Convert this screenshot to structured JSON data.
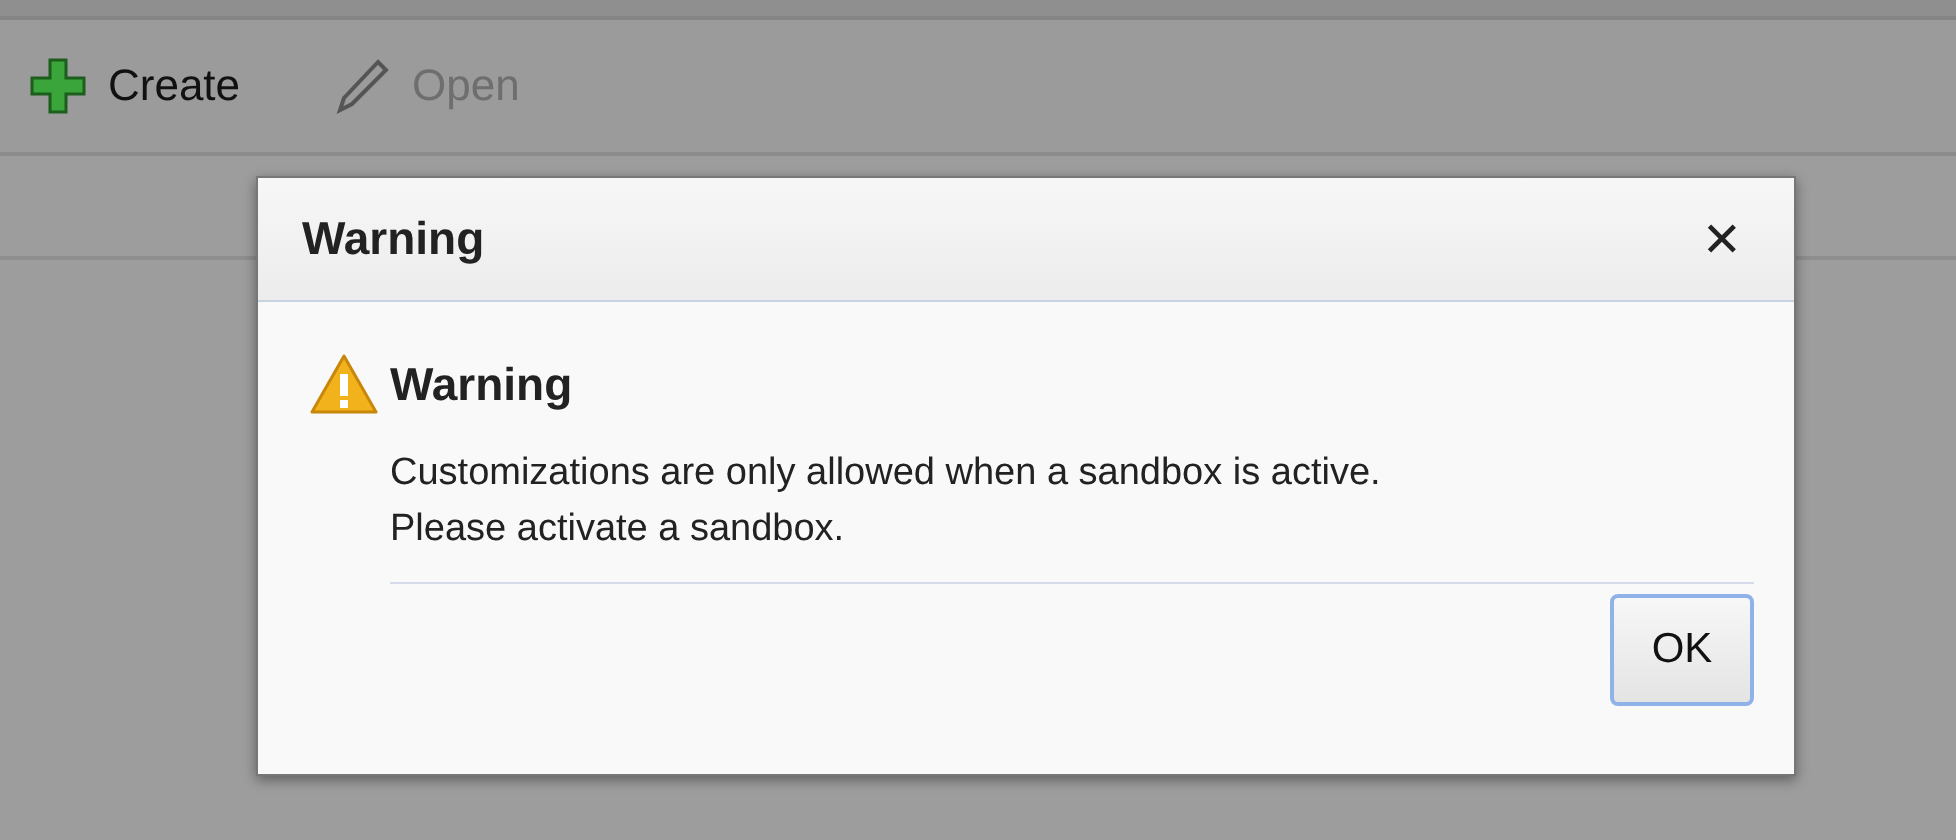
{
  "toolbar": {
    "items": [
      {
        "label": "Create",
        "kind": "create",
        "disabled": false
      },
      {
        "label": "Open",
        "kind": "edit",
        "disabled": true
      }
    ]
  },
  "dialog": {
    "title": "Warning",
    "close": "✕",
    "heading": "Warning",
    "message": [
      "Customizations are only allowed when a sandbox is active.",
      "Please activate a sandbox."
    ],
    "buttons": [
      {
        "label": "OK",
        "selected": true
      }
    ]
  }
}
